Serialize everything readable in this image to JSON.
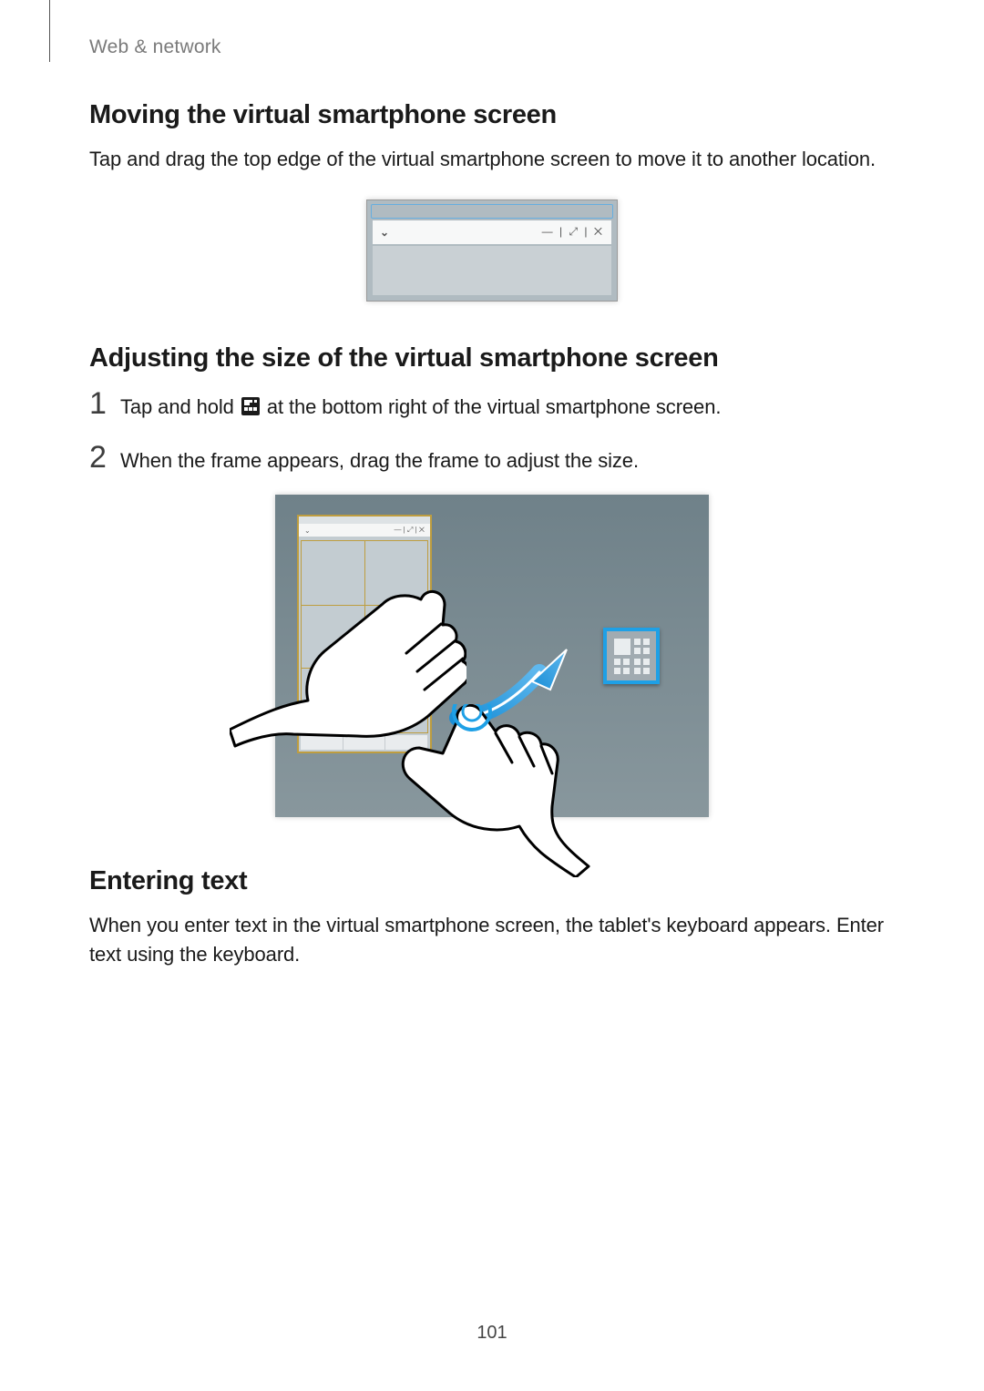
{
  "running_head": "Web & network",
  "section1": {
    "heading": "Moving the virtual smartphone screen",
    "body": "Tap and drag the top edge of the virtual smartphone screen to move it to another location."
  },
  "section2": {
    "heading": "Adjusting the size of the virtual smartphone screen",
    "steps": [
      {
        "num": "1",
        "before": "Tap and hold ",
        "after": " at the bottom right of the virtual smartphone screen."
      },
      {
        "num": "2",
        "before": "When the frame appears, drag the frame to adjust the size.",
        "after": ""
      }
    ]
  },
  "section3": {
    "heading": "Entering text",
    "body": "When you enter text in the virtual smartphone screen, the tablet's keyboard appears. Enter text using the keyboard."
  },
  "figure1": {
    "titlebar_left_glyph": "⌄",
    "titlebar_right": "—  |  ⤢  |  ✕"
  },
  "figure2": {
    "titlebar_left_glyph": "⌄",
    "titlebar_right": "— | ⤢ | ✕"
  },
  "page_number": "101"
}
